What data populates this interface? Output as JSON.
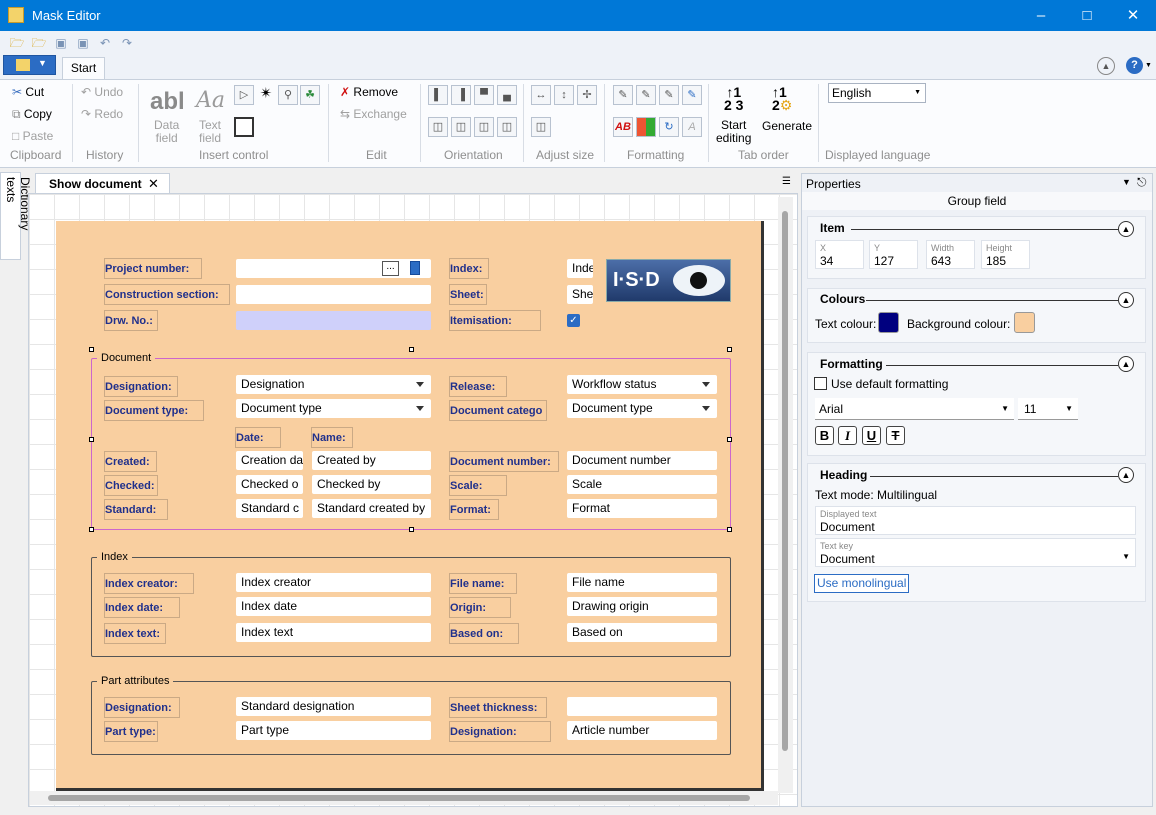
{
  "window": {
    "title": "Mask Editor"
  },
  "ribbon": {
    "tab": "Start",
    "clipboard": {
      "cut": "Cut",
      "copy": "Copy",
      "paste": "Paste",
      "label": "Clipboard"
    },
    "history": {
      "undo": "Undo",
      "redo": "Redo",
      "label": "History"
    },
    "insert": {
      "data_field": "Data\nfield",
      "text_field": "Text\nfield",
      "label": "Insert control"
    },
    "edit": {
      "remove": "Remove",
      "exchange": "Exchange",
      "label": "Edit"
    },
    "orientation": {
      "label": "Orientation"
    },
    "adjust": {
      "label": "Adjust size"
    },
    "formatting": {
      "label": "Formatting"
    },
    "taborder": {
      "start": "Start\nediting",
      "generate": "Generate",
      "label": "Tab order"
    },
    "language": {
      "value": "English",
      "label": "Displayed language"
    }
  },
  "sidebar": {
    "dictionary": "Dictionary texts"
  },
  "doc_tab": {
    "label": "Show document"
  },
  "mask": {
    "top": {
      "project_number": "Project number:",
      "construction_section": "Construction section:",
      "drw_no": "Drw. No.:",
      "index": "Index:",
      "sheet": "Sheet:",
      "itemisation": "Itemisation:",
      "index_val": "Inde",
      "sheet_val": "She",
      "ellipsis": "...",
      "logo": "I·S·D"
    },
    "document": {
      "legend": "Document",
      "designation": "Designation:",
      "designation_val": "Designation",
      "release": "Release:",
      "release_val": "Workflow status",
      "document_type": "Document type:",
      "document_type_val": "Document type",
      "document_category": "Document catego",
      "document_category_val": "Document type",
      "date": "Date:",
      "name": "Name:",
      "created": "Created:",
      "created_date": "Creation da",
      "created_by": "Created by",
      "checked": "Checked:",
      "checked_date": "Checked o",
      "checked_by": "Checked by",
      "standard": "Standard:",
      "standard_date": "Standard c",
      "standard_by": "Standard created by",
      "document_number": "Document number:",
      "document_number_val": "Document number",
      "scale": "Scale:",
      "scale_val": "Scale",
      "format": "Format:",
      "format_val": "Format"
    },
    "index": {
      "legend": "Index",
      "index_creator": "Index creator:",
      "index_creator_val": "Index creator",
      "index_date": "Index date:",
      "index_date_val": "Index date",
      "index_text": "Index text:",
      "index_text_val": "Index text",
      "file_name": "File name:",
      "file_name_val": "File name",
      "origin": "Origin:",
      "origin_val": "Drawing origin",
      "based_on": "Based on:",
      "based_on_val": "Based on"
    },
    "part": {
      "legend": "Part attributes",
      "designation": "Designation:",
      "designation_val": "Standard designation",
      "part_type": "Part type:",
      "part_type_val": "Part type",
      "sheet_thickness": "Sheet thickness:",
      "sheet_thickness_val": "",
      "designation2": "Designation:",
      "designation2_val": "Article number"
    }
  },
  "properties": {
    "title": "Properties",
    "subtitle": "Group field",
    "item": {
      "heading": "Item",
      "x_label": "X",
      "x": "34",
      "y_label": "Y",
      "y": "127",
      "w_label": "Width",
      "w": "643",
      "h_label": "Height",
      "h": "185"
    },
    "colours": {
      "heading": "Colours",
      "text_colour": "Text colour:",
      "background_colour": "Background colour:",
      "text_hex": "#00007f",
      "bg_hex": "#f9cfa0"
    },
    "formatting": {
      "heading": "Formatting",
      "use_default": "Use default formatting",
      "font": "Arial",
      "size": "11",
      "bold": "B",
      "italic": "I",
      "underline": "U",
      "strike": "T"
    },
    "heading": {
      "heading": "Heading",
      "text_mode": "Text mode: Multilingual",
      "displayed_text_label": "Displayed text",
      "displayed_text": "Document",
      "text_key_label": "Text key",
      "text_key": "Document",
      "use_mono": "Use monolingual"
    }
  }
}
